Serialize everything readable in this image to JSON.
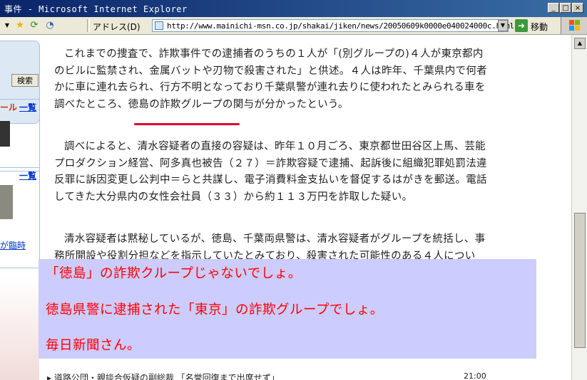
{
  "window": {
    "title": "事件 - Microsoft Internet Explorer",
    "min_glyph": "_",
    "max_glyph": "□",
    "close_glyph": "×"
  },
  "toolbar": {
    "address_label": "アドレス(D)",
    "url": "http://www.mainichi-msn.co.jp/shakai/jiken/news/20050609k0000e040024000c.html",
    "go_label": "移動",
    "icons": [
      "dropdown-arrow-icon",
      "favorites-star-icon",
      "refresh-icon",
      "history-icon"
    ]
  },
  "sidebar": {
    "search_button": "検索",
    "section1_label": "ール",
    "section1_link": "一覧",
    "section2_link": "一覧",
    "footer_link": "が臨時"
  },
  "article": {
    "para1": "これまでの捜査で、詐欺事件での逮捕者のうちの１人が「(別グループの)４人が東京都内のビルに監禁され、金属バットや刃物で殺害された」と供述。４人は昨年、千葉県内で何者かに車に連れ去られ、行方不明となっており千葉県警が連れ去りに使われたとみられる車を調べたところ、徳島の詐欺グループの関与が分かったという。",
    "para2": "調べによると、清水容疑者の直接の容疑は、昨年１０月ごろ、東京都世田谷区上馬、芸能プロダクション経営、阿多真也被告（２７）＝詐欺容疑で逮捕、起訴後に組織犯罪処罰法違反罪に訴因変更し公判中＝らと共謀し、電子消費料金支払いを督促するはがきを郵送。電話してきた大分県内の女性会社員（３３）から約１１３万円を詐取した疑い。",
    "para3": "清水容疑者は黙秘しているが、徳島、千葉両県警は、清水容疑者がグループを統括し、事務所開設や役割分担などを指示していたとみており、殺害された可能性のある４人につい"
  },
  "note": {
    "line1": "「徳島」の詐欺クループじゃないでしょ。",
    "line2": "徳島県警に逮捕された「東京」の詐欺グループでしょ。",
    "line3": "毎日新聞さん。",
    "color": "#ff0000",
    "background": "#ccccff"
  },
  "bottom_news": {
    "headline": "▸ 道路公団・親談合仮疑の副総裁 「名誉回復まで出席せず」",
    "time": "21:00"
  },
  "colors": {
    "titlebar": "#0a246a",
    "underline": "#e00030",
    "link": "#0033cc"
  }
}
